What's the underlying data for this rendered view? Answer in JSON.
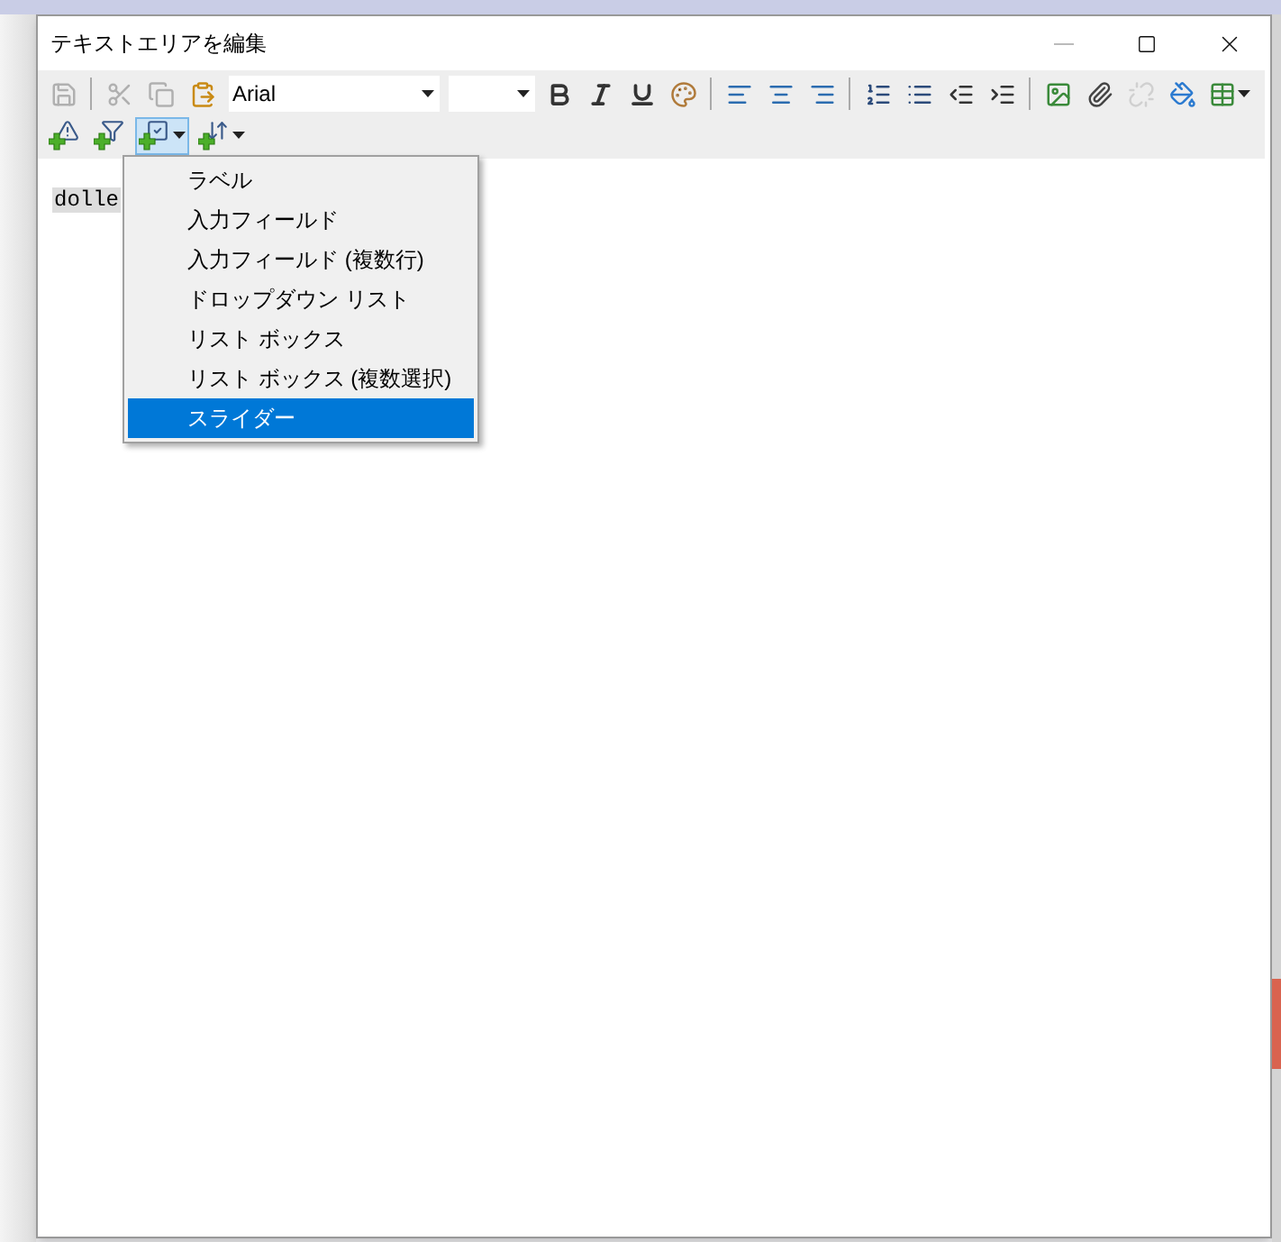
{
  "window": {
    "title": "テキストエリアを編集"
  },
  "toolbar": {
    "file_buttons": [
      {
        "disabled": true
      },
      {
        "disabled": true
      },
      {
        "disabled": true
      },
      {
        "disabled": false
      }
    ],
    "font": {
      "value": "Arial"
    },
    "format_buttons": [
      {
        "disabled": false
      },
      {
        "disabled": false
      },
      {
        "disabled": false
      },
      {
        "disabled": false
      },
      {
        "disabled": false
      },
      {
        "disabled": false
      },
      {
        "disabled": false
      },
      {
        "disabled": false
      },
      {
        "disabled": false
      },
      {
        "disabled": false
      },
      {
        "disabled": false
      },
      {
        "disabled": false
      },
      {
        "disabled": false
      },
      {
        "disabled": true
      },
      {
        "disabled": false
      },
      {
        "disabled": false
      }
    ],
    "insert_buttons": [
      {
        "expanded": false
      },
      {
        "expanded": false
      },
      {
        "expanded": true
      },
      {
        "expanded": false
      }
    ]
  },
  "editor": {
    "text": "dolle"
  },
  "menu": {
    "items": [
      {
        "label": "ラベル",
        "selected": false
      },
      {
        "label": "入力フィールド",
        "selected": false
      },
      {
        "label": "入力フィールド (複数行)",
        "selected": false
      },
      {
        "label": "ドロップダウン リスト",
        "selected": false
      },
      {
        "label": "リスト ボックス",
        "selected": false
      },
      {
        "label": "リスト ボックス (複数選択)",
        "selected": false
      },
      {
        "label": "スライダー",
        "selected": true
      }
    ]
  }
}
